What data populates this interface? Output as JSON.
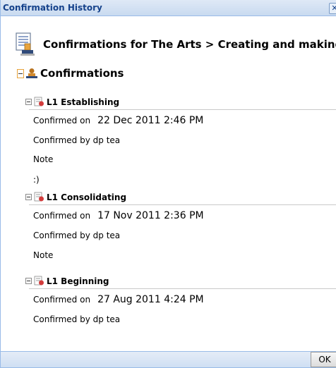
{
  "window": {
    "title": "Confirmation History"
  },
  "header": {
    "title": "Confirmations for The Arts > Creating and making"
  },
  "section": {
    "title": "Confirmations"
  },
  "items": [
    {
      "name": "L1 Establishing",
      "confirmed_on_label": "Confirmed on",
      "date": "22 Dec 2011 2:46 PM",
      "confirmed_by": "Confirmed by dp tea",
      "note_label": "Note",
      "note": ":)"
    },
    {
      "name": "L1 Consolidating",
      "confirmed_on_label": "Confirmed on",
      "date": "17 Nov 2011 2:36 PM",
      "confirmed_by": "Confirmed by dp tea",
      "note_label": "Note"
    },
    {
      "name": "L1 Beginning",
      "confirmed_on_label": "Confirmed on",
      "date": "27 Aug 2011 4:24 PM",
      "confirmed_by": "Confirmed by dp tea"
    }
  ],
  "footer": {
    "ok_label": "OK"
  },
  "colors": {
    "title_text": "#15428b",
    "frame": "#99bbe8",
    "accent_orange": "#e8a33c"
  }
}
